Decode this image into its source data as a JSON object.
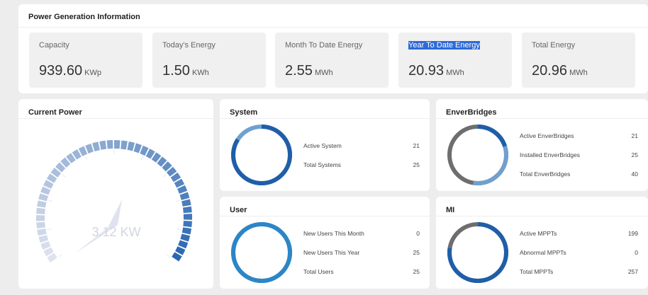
{
  "power_generation": {
    "title": "Power Generation Information",
    "cards": [
      {
        "label": "Capacity",
        "value": "939.60",
        "unit": "KWp",
        "highlighted": false
      },
      {
        "label": "Today's Energy",
        "value": "1.50",
        "unit": "KWh",
        "highlighted": false
      },
      {
        "label": "Month To Date Energy",
        "value": "2.55",
        "unit": "MWh",
        "highlighted": false
      },
      {
        "label": "Year To Date Energy",
        "value": "20.93",
        "unit": "MWh",
        "highlighted": true
      },
      {
        "label": "Total Energy",
        "value": "20.96",
        "unit": "MWh",
        "highlighted": false
      }
    ]
  },
  "current_power": {
    "title": "Current Power",
    "value_text": "3.12 KW",
    "gauge_fraction": 0.2
  },
  "system": {
    "title": "System",
    "ring_fraction": 0.84,
    "rows": [
      {
        "label": "Active System",
        "value": "21"
      },
      {
        "label": "Total Systems",
        "value": "25"
      }
    ]
  },
  "enverbridges": {
    "title": "EnverBridges",
    "ring_fraction": 0.525,
    "rows": [
      {
        "label": "Active EnverBridges",
        "value": "21"
      },
      {
        "label": "Installed EnverBridges",
        "value": "25"
      },
      {
        "label": "Total EnverBridges",
        "value": "40"
      }
    ]
  },
  "user": {
    "title": "User",
    "ring_fraction": 1.0,
    "rows": [
      {
        "label": "New Users This Month",
        "value": "0"
      },
      {
        "label": "New Users This Year",
        "value": "25"
      },
      {
        "label": "Total Users",
        "value": "25"
      }
    ]
  },
  "mi": {
    "title": "MI",
    "ring_fraction": 0.774,
    "rows": [
      {
        "label": "Active MPPTs",
        "value": "199"
      },
      {
        "label": "Abnormal MPPTs",
        "value": "0"
      },
      {
        "label": "Total MPPTs",
        "value": "257"
      }
    ]
  },
  "colors": {
    "page_bg": "#ededed",
    "card_bg": "#f0f0f0",
    "highlight": "#2f6ad6",
    "ring_dark_blue": "#1f5ea8",
    "ring_light_blue": "#6fa0cf",
    "ring_mid_blue": "#2b86c8",
    "ring_grey": "#6e6e6e",
    "gauge_light": "#dfe3ee",
    "gauge_dark": "#2a67b1"
  }
}
